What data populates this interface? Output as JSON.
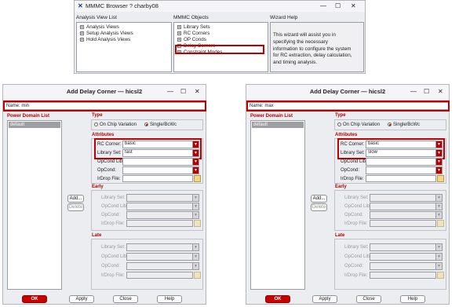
{
  "mmmc": {
    "title": "MMMC Browser ? charby08",
    "col_analysis": "Analysis View List",
    "col_objects": "MMMC Objects",
    "col_wizard": "Wizard Help",
    "analysis_items": [
      "Analysis Views",
      "Setup Analysis Views",
      "Hold Analysis Views"
    ],
    "object_items": [
      "Library Sets",
      "RC Corners",
      "OP Conds",
      "Delay Corners",
      "Constraint Modes"
    ],
    "wizard_text": [
      "This wizard will assist you in",
      "specifying the necessary",
      "information to configure the system",
      "for RC extraction, delay calculation,",
      "and timing analysis."
    ]
  },
  "dialogs": [
    {
      "title": "Add Delay Corner — hicsl2",
      "name_label": "Name:",
      "name_value": "min",
      "power_domain_label": "Power Domain List",
      "power_domain_items": [
        "default"
      ],
      "add_label": "Add...",
      "delete_label": "Delete",
      "type_label": "Type",
      "radio_onchip": "On Chip Variation",
      "radio_single": "Single/BcWc",
      "attributes_label": "Attributes",
      "rc_corner_label": "RC Corner:",
      "rc_corner_value": "basic",
      "library_set_label": "Library Set:",
      "library_set_value": "fast",
      "opcond_lib_label": "OpCond Lib:",
      "opcond_label": "OpCond:",
      "irdrop_label": "IrDrop File:",
      "early_label": "Early",
      "late_label": "Late",
      "ok_label": "OK",
      "apply_label": "Apply",
      "close_label": "Close",
      "help_label": "Help"
    },
    {
      "title": "Add Delay Corner — hicsl2",
      "name_label": "Name:",
      "name_value": "max",
      "power_domain_label": "Power Domain List",
      "power_domain_items": [
        "default"
      ],
      "add_label": "Add...",
      "delete_label": "Delete",
      "type_label": "Type",
      "radio_onchip": "On Chip Variation",
      "radio_single": "Single/BcWc",
      "attributes_label": "Attributes",
      "rc_corner_label": "RC Corner:",
      "rc_corner_value": "basic",
      "library_set_label": "Library Set:",
      "library_set_value": "slow",
      "opcond_lib_label": "OpCond Lib:",
      "opcond_label": "OpCond:",
      "irdrop_label": "IrDrop File:",
      "early_label": "Early",
      "late_label": "Late",
      "ok_label": "OK",
      "apply_label": "Apply",
      "close_label": "Close",
      "help_label": "Help"
    }
  ],
  "icons": {
    "minimize": "—",
    "maximize": "☐",
    "close": "✕",
    "dropdown": "▼",
    "folder": "📁",
    "expand": "+"
  },
  "colors": {
    "highlight_red": "#c00000",
    "section_red": "#b00000"
  }
}
